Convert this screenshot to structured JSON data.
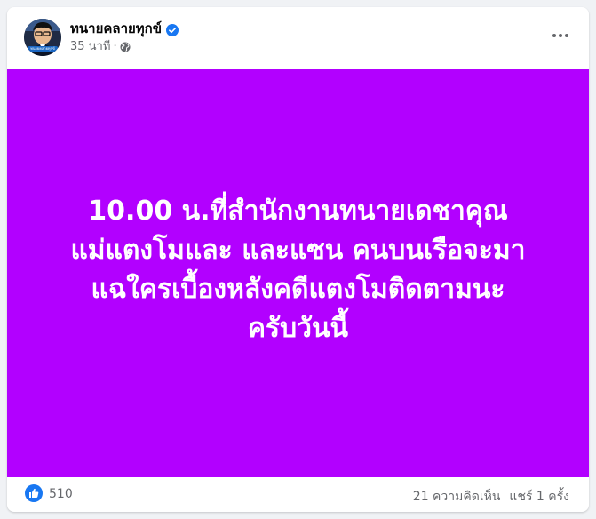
{
  "post": {
    "author_name": "ทนายคลายทุกข์",
    "time": "35 นาที",
    "meta_separator": "·",
    "avatar_caption": "ทนายคลายทุกข์",
    "verified_icon": "verified-badge-icon",
    "audience_icon": "globe-icon",
    "more_icon": "more-options-icon"
  },
  "media": {
    "background_color": "#b200ff",
    "text_color": "#ffffff",
    "lines": [
      "10.00 น.ที่สำนักงานทนายเดชาคุณ",
      "แม่แตงโมและ และแซน คนบนเรือจะมา",
      "แฉใครเบื้องหลังคดีแตงโมติดตามนะ",
      "ครับวันนี้"
    ]
  },
  "footer": {
    "reaction_icon": "like-reaction-icon",
    "reactions_count": "510",
    "comments": "21 ความคิดเห็น",
    "shares": "แชร์ 1 ครั้ง"
  }
}
